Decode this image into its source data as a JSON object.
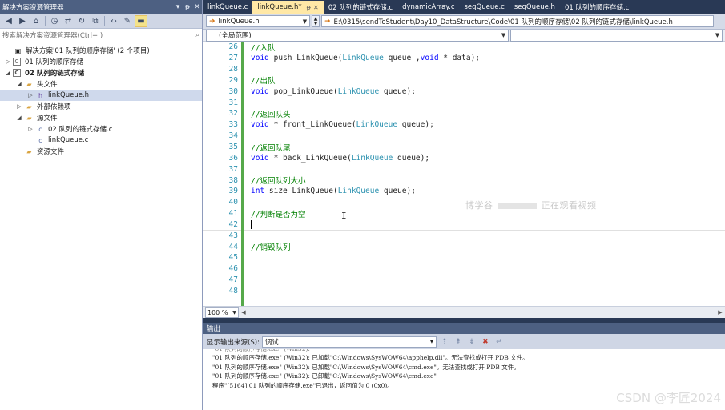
{
  "solution_explorer": {
    "title": "解决方案资源管理器",
    "title_buttons": [
      "▾",
      "ᵽ",
      "✕"
    ],
    "search_placeholder": "搜索解决方案资源管理器(Ctrl+;)",
    "tree": [
      {
        "label": "解决方案'01 队列的顺序存储' (2 个项目)",
        "depth": 0,
        "icon": "solution-icon",
        "expand": "",
        "bold": false,
        "selected": false
      },
      {
        "label": "01 队列的顺序存储",
        "depth": 0,
        "icon": "project-icon",
        "expand": "▷",
        "bold": false,
        "selected": false
      },
      {
        "label": "02 队列的链式存储",
        "depth": 0,
        "icon": "project-icon",
        "expand": "◢",
        "bold": true,
        "selected": false
      },
      {
        "label": "头文件",
        "depth": 1,
        "icon": "folder-icon",
        "expand": "◢",
        "bold": false,
        "selected": false
      },
      {
        "label": "linkQueue.h",
        "depth": 2,
        "icon": "header-file-icon",
        "expand": "▷",
        "bold": false,
        "selected": true
      },
      {
        "label": "外部依赖项",
        "depth": 1,
        "icon": "folder-icon",
        "expand": "▷",
        "bold": false,
        "selected": false
      },
      {
        "label": "源文件",
        "depth": 1,
        "icon": "folder-icon",
        "expand": "◢",
        "bold": false,
        "selected": false
      },
      {
        "label": "02 队列的链式存储.c",
        "depth": 2,
        "icon": "source-file-icon",
        "expand": "▷",
        "bold": false,
        "selected": false
      },
      {
        "label": "linkQueue.c",
        "depth": 2,
        "icon": "source-file-icon",
        "expand": "",
        "bold": false,
        "selected": false
      },
      {
        "label": "资源文件",
        "depth": 1,
        "icon": "folder-icon",
        "expand": "",
        "bold": false,
        "selected": false
      }
    ]
  },
  "tabs": [
    {
      "label": "linkQueue.c",
      "active": false
    },
    {
      "label": "linkQueue.h*",
      "active": true
    },
    {
      "label": "02 队列的链式存储.c",
      "active": false
    },
    {
      "label": "dynamicArray.c",
      "active": false
    },
    {
      "label": "seqQueue.c",
      "active": false
    },
    {
      "label": "seqQueue.h",
      "active": false
    },
    {
      "label": "01 队列的顺序存储.c",
      "active": false
    }
  ],
  "navbar": {
    "file_combo": "linkQueue.h",
    "path_combo": "E:\\0315\\sendToStudent\\Day10_DataStructure\\Code\\01 队列的顺序存储\\02 队列的链式存储\\linkQueue.h",
    "scope_combo": "(全局范围)"
  },
  "code_lines": [
    {
      "n": "26",
      "tokens": [
        {
          "t": "//入队",
          "c": "cm"
        }
      ]
    },
    {
      "n": "27",
      "tokens": [
        {
          "t": "void",
          "c": "kw"
        },
        {
          "t": " push_LinkQueue(",
          "c": "fn"
        },
        {
          "t": "LinkQueue",
          "c": "ty"
        },
        {
          "t": " queue ,",
          "c": "fn"
        },
        {
          "t": "void",
          "c": "kw"
        },
        {
          "t": " * data);",
          "c": "fn"
        }
      ]
    },
    {
      "n": "28",
      "tokens": []
    },
    {
      "n": "29",
      "tokens": [
        {
          "t": "//出队",
          "c": "cm"
        }
      ]
    },
    {
      "n": "30",
      "tokens": [
        {
          "t": "void",
          "c": "kw"
        },
        {
          "t": " pop_LinkQueue(",
          "c": "fn"
        },
        {
          "t": "LinkQueue",
          "c": "ty"
        },
        {
          "t": " queue);",
          "c": "fn"
        }
      ]
    },
    {
      "n": "31",
      "tokens": []
    },
    {
      "n": "32",
      "tokens": [
        {
          "t": "//返回队头",
          "c": "cm"
        }
      ]
    },
    {
      "n": "33",
      "tokens": [
        {
          "t": "void",
          "c": "kw"
        },
        {
          "t": " * front_LinkQueue(",
          "c": "fn"
        },
        {
          "t": "LinkQueue",
          "c": "ty"
        },
        {
          "t": " queue);",
          "c": "fn"
        }
      ]
    },
    {
      "n": "34",
      "tokens": []
    },
    {
      "n": "35",
      "tokens": [
        {
          "t": "//返回队尾",
          "c": "cm"
        }
      ]
    },
    {
      "n": "36",
      "tokens": [
        {
          "t": "void",
          "c": "kw"
        },
        {
          "t": " * back_LinkQueue(",
          "c": "fn"
        },
        {
          "t": "LinkQueue",
          "c": "ty"
        },
        {
          "t": " queue);",
          "c": "fn"
        }
      ]
    },
    {
      "n": "37",
      "tokens": []
    },
    {
      "n": "38",
      "tokens": [
        {
          "t": "//返回队列大小",
          "c": "cm"
        }
      ]
    },
    {
      "n": "39",
      "tokens": [
        {
          "t": "int",
          "c": "kw"
        },
        {
          "t": " size_LinkQueue(",
          "c": "fn"
        },
        {
          "t": "LinkQueue",
          "c": "ty"
        },
        {
          "t": " queue);",
          "c": "fn"
        }
      ]
    },
    {
      "n": "40",
      "tokens": []
    },
    {
      "n": "41",
      "tokens": [
        {
          "t": "//判断是否为空",
          "c": "cm"
        }
      ]
    },
    {
      "n": "42",
      "tokens": [],
      "cursor": true
    },
    {
      "n": "43",
      "tokens": []
    },
    {
      "n": "44",
      "tokens": [
        {
          "t": "//销毁队列",
          "c": "cm"
        }
      ]
    },
    {
      "n": "45",
      "tokens": []
    },
    {
      "n": "46",
      "tokens": []
    },
    {
      "n": "47",
      "tokens": []
    },
    {
      "n": "48",
      "tokens": []
    }
  ],
  "editor_overlay": {
    "left": "博学谷",
    "right": "正在观看视频"
  },
  "zoom": "100 %",
  "output": {
    "title": "输出",
    "source_label": "显示输出来源(S):",
    "source_value": "调试",
    "lines": [
      "\"01 队列的顺序存储.exe\" (Win32):  已加载\"C:\\Windows\\SysWOW64\\apphelp.dll\"。无法查找或打开 PDB 文件。",
      "\"01 队列的顺序存储.exe\" (Win32):  已加载\"C:\\Windows\\SysWOW64\\cmd.exe\"。无法查找或打开 PDB 文件。",
      "\"01 队列的顺序存储.exe\" (Win32):  已卸载\"C:\\Windows\\SysWOW64\\cmd.exe\"",
      "程序\"[5164] 01 队列的顺序存储.exe\"已退出，返回值为 0 (0x0)。"
    ]
  },
  "watermark": "CSDN @李匠2024"
}
